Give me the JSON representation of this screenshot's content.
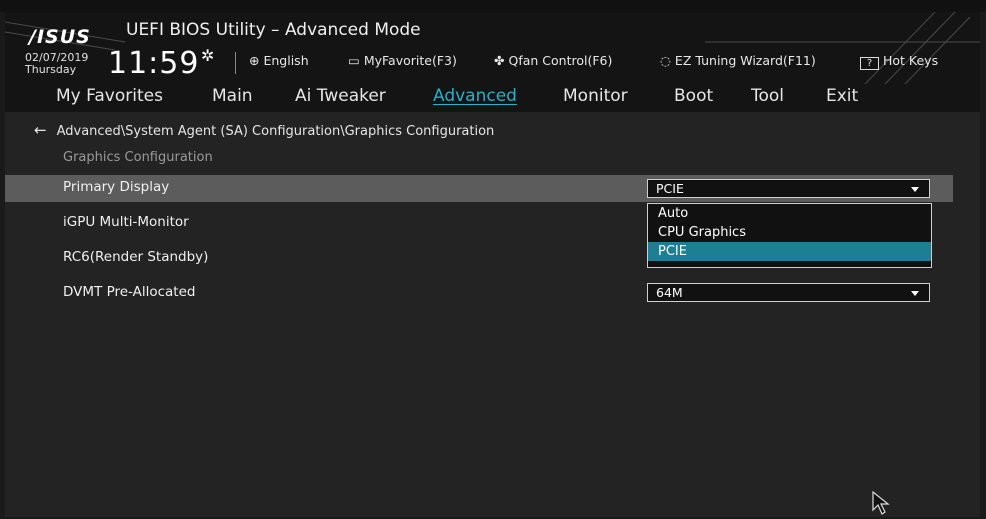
{
  "header": {
    "logo": "/ISUS",
    "title": "UEFI BIOS Utility – Advanced Mode",
    "date": "02/07/2019",
    "day": "Thursday",
    "time": "11:59",
    "tools": {
      "language": "English",
      "favorite": "MyFavorite(F3)",
      "qfan": "Qfan Control(F6)",
      "ez_tuning": "EZ Tuning Wizard(F11)",
      "hotkeys": "Hot Keys",
      "hotkeys_icon_text": "?"
    }
  },
  "nav": {
    "tabs": [
      "My Favorites",
      "Main",
      "Ai Tweaker",
      "Advanced",
      "Monitor",
      "Boot",
      "Tool",
      "Exit"
    ],
    "active": "Advanced"
  },
  "breadcrumb": "Advanced\\System Agent (SA) Configuration\\Graphics Configuration",
  "section_title": "Graphics Configuration",
  "settings": [
    {
      "label": "Primary Display",
      "value": "PCIE"
    },
    {
      "label": "iGPU Multi-Monitor"
    },
    {
      "label": "RC6(Render Standby)"
    },
    {
      "label": "DVMT Pre-Allocated",
      "value": "64M"
    }
  ],
  "dropdown": {
    "options": [
      "Auto",
      "CPU Graphics",
      "PCIE"
    ],
    "selected": "PCIE"
  },
  "colors": {
    "accent": "#28b0c8",
    "selected_option": "#1c7f93",
    "highlight_row": "#5c5c5c"
  }
}
